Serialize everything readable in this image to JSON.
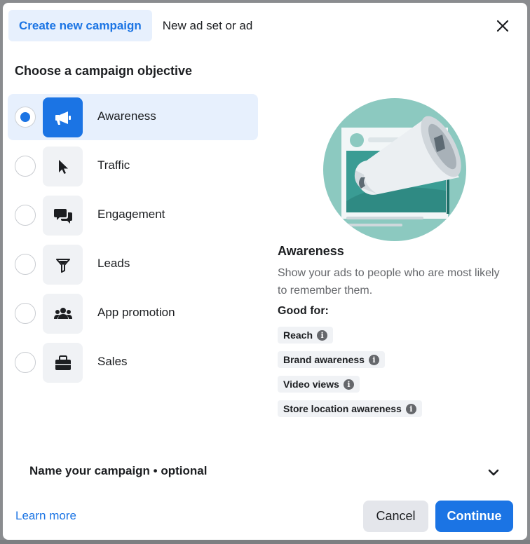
{
  "tabs": [
    {
      "label": "Create new campaign",
      "active": true
    },
    {
      "label": "New ad set or ad",
      "active": false
    }
  ],
  "section_title": "Choose a campaign objective",
  "objectives": [
    {
      "label": "Awareness",
      "icon": "megaphone-icon",
      "selected": true
    },
    {
      "label": "Traffic",
      "icon": "cursor-icon",
      "selected": false
    },
    {
      "label": "Engagement",
      "icon": "chat-bubbles-icon",
      "selected": false
    },
    {
      "label": "Leads",
      "icon": "funnel-icon",
      "selected": false
    },
    {
      "label": "App promotion",
      "icon": "people-icon",
      "selected": false
    },
    {
      "label": "Sales",
      "icon": "briefcase-icon",
      "selected": false
    }
  ],
  "detail": {
    "title": "Awareness",
    "description": "Show your ads to people who are most likely to remember them.",
    "good_for_label": "Good for:",
    "good_for": [
      "Reach",
      "Brand awareness",
      "Video views",
      "Store location awareness"
    ]
  },
  "name_campaign_label": "Name your campaign • optional",
  "footer": {
    "learn_more": "Learn more",
    "cancel": "Cancel",
    "continue": "Continue"
  },
  "colors": {
    "accent": "#1b74e4",
    "selected_bg": "#e7f0fd",
    "chip_bg": "#f0f2f5",
    "illustration_teal": "#8cc9c0"
  }
}
